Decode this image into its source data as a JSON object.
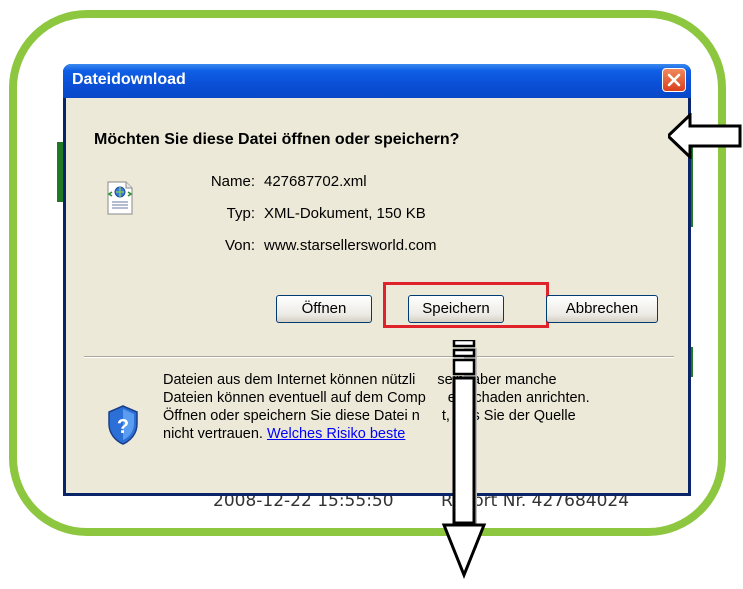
{
  "dialog": {
    "title": "Dateidownload",
    "question": "Möchten Sie diese Datei öffnen oder speichern?",
    "name_label": "Name:",
    "name_value": "427687702.xml",
    "type_label": "Typ:",
    "type_value": "XML-Dokument, 150 KB",
    "from_label": "Von:",
    "from_value": "www.starsellersworld.com",
    "buttons": {
      "open": "Öffnen",
      "save": "Speichern",
      "cancel": "Abbrechen"
    },
    "warning": {
      "line1": "Dateien aus dem Internet können nützli",
      "line1b": "sein, aber manche",
      "line2": "Dateien können eventuell auf dem Comp",
      "line2b": "er Schaden anrichten.",
      "line3": "Öffnen oder speichern Sie diese Datei n",
      "line3b": "t, falls Sie der Quelle",
      "line4": "nicht vertrauen.",
      "link": "Welches Risiko beste"
    }
  },
  "background": {
    "bottom_text": "2008-12-22 15:55:50",
    "bottom_text2": "Report Nr. 427684024"
  },
  "colors": {
    "frame": "#8dc63f",
    "highlight": "#e0232b",
    "titlebar": "#0a4fd6"
  }
}
